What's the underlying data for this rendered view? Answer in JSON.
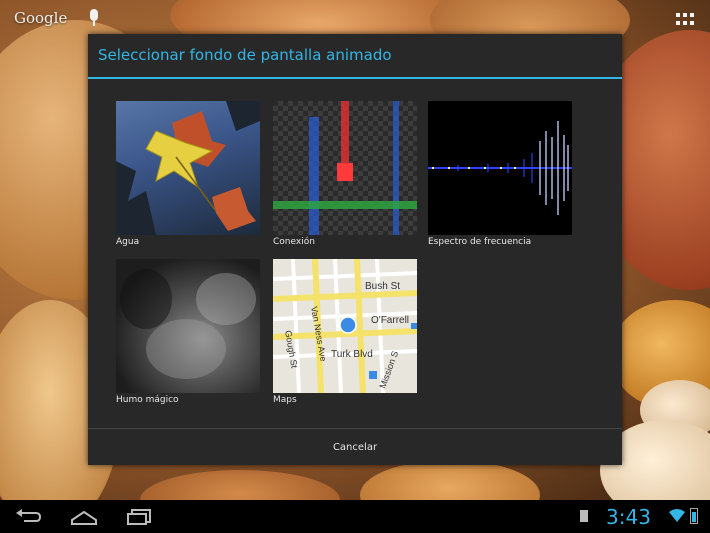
{
  "topbar": {
    "search_brand": "Google"
  },
  "dialog": {
    "title": "Seleccionar fondo de pantalla animado",
    "items": [
      {
        "label": "Agua"
      },
      {
        "label": "Conexión"
      },
      {
        "label": "Espectro de frecuencia"
      },
      {
        "label": "Humo mágico"
      },
      {
        "label": "Maps"
      }
    ],
    "map_streets": [
      "Bush St",
      "O'Farrell",
      "Turk Blvd",
      "Van Ness Ave",
      "Gough St",
      "Mission S"
    ],
    "cancel_label": "Cancelar"
  },
  "status": {
    "time": "3:43"
  },
  "colors": {
    "accent": "#33b5e5",
    "dialog_bg": "#282828"
  }
}
